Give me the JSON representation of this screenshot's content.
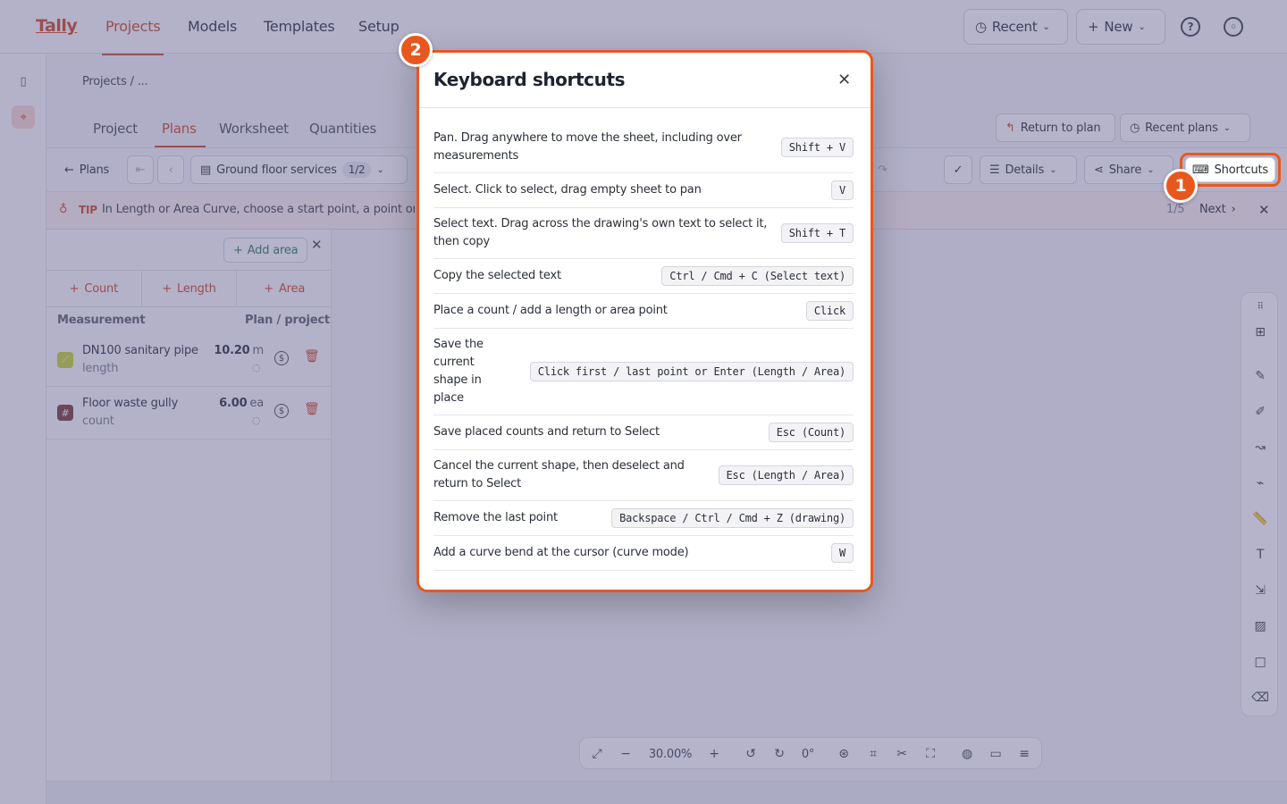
{
  "nav": {
    "logo": "Tally",
    "links": [
      "Projects",
      "Models",
      "Templates",
      "Setup"
    ],
    "recent": "Recent",
    "new": "New"
  },
  "header": {
    "breadcrumb": "Projects / ...",
    "tabs": [
      "Project",
      "Plans",
      "Worksheet",
      "Quantities"
    ],
    "return_to_plan": "Return to plan",
    "recent_plans": "Recent plans"
  },
  "toolbar": {
    "plans": "Plans",
    "sheet_name": "Ground floor services",
    "sheet_count": "1/2",
    "details": "Details",
    "share": "Share",
    "shortcuts": "Shortcuts"
  },
  "tip": {
    "label": "TIP",
    "text": "In Length or Area Curve, choose a start point, a point on the c",
    "progress": "1/5",
    "next": "Next"
  },
  "panel": {
    "add_area": "Add area",
    "tabs": [
      "Count",
      "Length",
      "Area"
    ],
    "col_measurement": "Measurement",
    "col_plan_project": "Plan / project",
    "rows": [
      {
        "name": "DN100 sanitary pipe",
        "type": "length",
        "value": "10.20",
        "unit": "m",
        "color": "#c9d32a"
      },
      {
        "name": "Floor waste gully",
        "type": "count",
        "value": "6.00",
        "unit": "ea",
        "color": "#7a3a32"
      }
    ]
  },
  "zoom": "30.00%",
  "rotation": "0°",
  "modal": {
    "title": "Keyboard shortcuts",
    "shortcuts": [
      {
        "desc": "Pan. Drag anywhere to move the sheet, including over measurements",
        "key": "Shift + V"
      },
      {
        "desc": "Select. Click to select, drag empty sheet to pan",
        "key": "V"
      },
      {
        "desc": "Select text. Drag across the drawing's own text to select it, then copy",
        "key": "Shift + T"
      },
      {
        "desc": "Copy the selected text",
        "key": "Ctrl / Cmd + C (Select text)"
      },
      {
        "desc": "Place a count / add a length or area point",
        "key": "Click"
      },
      {
        "desc": "Save the current shape in place",
        "key": "Click first / last point or Enter (Length / Area)"
      },
      {
        "desc": "Save placed counts and return to Select",
        "key": "Esc (Count)"
      },
      {
        "desc": "Cancel the current shape, then deselect and return to Select",
        "key": "Esc (Length / Area)"
      },
      {
        "desc": "Remove the last point",
        "key": "Backspace / Ctrl / Cmd + Z (drawing)"
      },
      {
        "desc": "Add a curve bend at the cursor (curve mode)",
        "key": "W"
      }
    ]
  },
  "callouts": {
    "one": "1",
    "two": "2"
  },
  "colors": {
    "accent": "#d2451e",
    "highlight": "#e8581e"
  }
}
